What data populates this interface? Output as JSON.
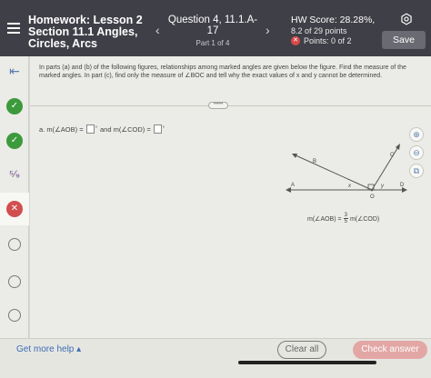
{
  "header": {
    "title_line1": "Homework: Lesson 2",
    "title_line2": "Section 11.1 Angles,",
    "title_line3": "Circles, Arcs",
    "question_line1": "Question 4, 11.1.A-",
    "question_line2": "17",
    "question_part": "Part 1 of 4",
    "score_title": "HW Score: 28.28%,",
    "score_points": "8.2 of 29 points",
    "score_status": "Points: 0 of 2",
    "save_label": "Save",
    "prev_arrow": "‹",
    "next_arrow": "›"
  },
  "sidebar": {
    "icons": [
      "collapse-icon",
      "check-icon",
      "check-icon",
      "partial-icon",
      "wrong-icon",
      "open-circle-icon",
      "open-circle-icon",
      "open-circle-icon"
    ],
    "partial_text": "⁵⁄₉"
  },
  "main": {
    "instructions": "In parts (a) and (b) of the following figures, relationships among marked angles are given below the figure. Find the measure of the marked angles. In part (c), find only the measure of ∠BOC and tell why the exact values of x and y cannot be determined.",
    "divider_handle": "•••••",
    "part_a_prefix": "a. m(∠AOB) =",
    "part_a_degree": "°",
    "part_a_middle": "and m(∠COD) =",
    "part_a_degree2": "°",
    "figure_labels": {
      "a": "A",
      "b": "B",
      "c": "C",
      "d": "D",
      "o": "O",
      "x": "x",
      "y": "y"
    },
    "relation_left": "m(∠AOB) =",
    "relation_num": "3",
    "relation_den": "5",
    "relation_right": "m(∠COD)"
  },
  "footer": {
    "help_label": "Get more help ▴",
    "clear_label": "Clear all",
    "check_label": "Check answer"
  },
  "colors": {
    "header_bg": "#3f3f47",
    "correct": "#3c9a3c",
    "incorrect": "#d24f4f",
    "link": "#3c6db5",
    "check_button": "#e2a7a4"
  }
}
